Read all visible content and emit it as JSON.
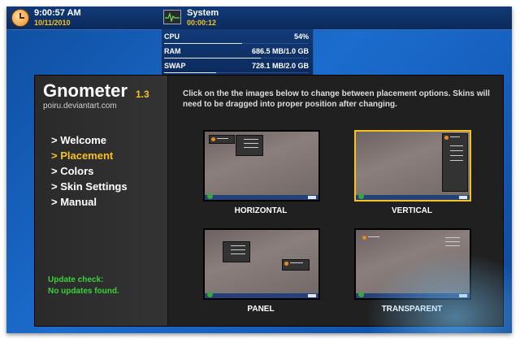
{
  "clock": {
    "time": "9:00:57 AM",
    "date": "10/11/2010"
  },
  "system": {
    "title": "System",
    "uptime": "00:00:12",
    "stats": [
      {
        "label": "CPU",
        "value": "54%",
        "usage": 0.54
      },
      {
        "label": "RAM",
        "value": "686.5 MB/1.0 GB",
        "usage": 0.67
      },
      {
        "label": "SWAP",
        "value": "728.1 MB/2.0 GB",
        "usage": 0.36
      }
    ]
  },
  "app": {
    "title": "Gnometer",
    "version": "1.3",
    "subtitle": "poiru.deviantart.com",
    "menu": [
      {
        "label": "> Welcome",
        "active": false
      },
      {
        "label": "> Placement",
        "active": true
      },
      {
        "label": "> Colors",
        "active": false
      },
      {
        "label": "> Skin Settings",
        "active": false
      },
      {
        "label": "> Manual",
        "active": false
      }
    ],
    "update_line1": "Update check:",
    "update_line2": "No updates found.",
    "instructions": "Click on the the images below to change between placement options. Skins will need to be dragged into proper position after changing.",
    "options": [
      {
        "label": "HORIZONTAL",
        "selected": false
      },
      {
        "label": "VERTICAL",
        "selected": true
      },
      {
        "label": "PANEL",
        "selected": false
      },
      {
        "label": "TRANSPARENT",
        "selected": false
      }
    ]
  },
  "colors": {
    "accent": "#f7c21c",
    "update": "#3ccf3c",
    "bar": "#0b2a5c"
  }
}
